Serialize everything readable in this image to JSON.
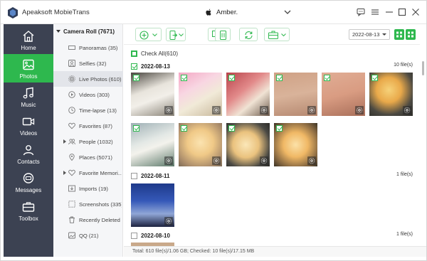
{
  "app": {
    "title": "Apeaksoft MobieTrans",
    "device_name": "Amber."
  },
  "nav": [
    {
      "key": "home",
      "label": "Home",
      "icon": "home-icon"
    },
    {
      "key": "photos",
      "label": "Photos",
      "icon": "photos-icon",
      "active": true
    },
    {
      "key": "music",
      "label": "Music",
      "icon": "music-icon"
    },
    {
      "key": "videos",
      "label": "Videos",
      "icon": "video-icon"
    },
    {
      "key": "contacts",
      "label": "Contacts",
      "icon": "contacts-icon"
    },
    {
      "key": "messages",
      "label": "Messages",
      "icon": "messages-icon"
    },
    {
      "key": "toolbox",
      "label": "Toolbox",
      "icon": "toolbox-icon"
    }
  ],
  "categories": {
    "header": "Camera Roll (7671)",
    "items": [
      {
        "label": "Panoramas (35)",
        "icon": "panorama-icon"
      },
      {
        "label": "Selfies (32)",
        "icon": "selfie-icon"
      },
      {
        "label": "Live Photos (610)",
        "icon": "live-photo-icon",
        "active": true
      },
      {
        "label": "Videos (303)",
        "icon": "video-icon"
      },
      {
        "label": "Time-lapse (13)",
        "icon": "timelapse-icon"
      },
      {
        "label": "Favorites (87)",
        "icon": "heart-icon"
      },
      {
        "label": "People (1032)",
        "icon": "people-icon",
        "expandable": true
      },
      {
        "label": "Places (5071)",
        "icon": "location-icon"
      },
      {
        "label": "Favorite Memori...",
        "icon": "heart-icon",
        "expandable": true
      },
      {
        "label": "Imports (19)",
        "icon": "import-icon"
      },
      {
        "label": "Screenshots (335)",
        "icon": "screenshot-icon"
      },
      {
        "label": "Recently Deleted ...",
        "icon": "trash-icon"
      },
      {
        "label": "QQ (21)",
        "icon": "album-icon"
      }
    ]
  },
  "toolbar": {
    "buttons": [
      "add-icon",
      "export-to-device-icon",
      "export-to-pc-icon",
      "delete-icon",
      "sync-icon",
      "toolbox-icon"
    ],
    "date_value": "2022-08-13"
  },
  "content": {
    "check_all_label": "Check All(610)",
    "groups": [
      {
        "date": "2022-08-13",
        "count_label": "10 file(s)",
        "checked": true
      },
      {
        "date": "2022-08-11",
        "count_label": "1 file(s)",
        "checked": false
      },
      {
        "date": "2022-08-10",
        "count_label": "1 file(s)",
        "checked": false
      }
    ]
  },
  "status": {
    "text": "Total: 610 file(s)/1.06 GB; Checked: 10 file(s)/17.15 MB"
  },
  "colors": {
    "accent": "#2eb84e",
    "nav_bg": "#3c4252"
  }
}
